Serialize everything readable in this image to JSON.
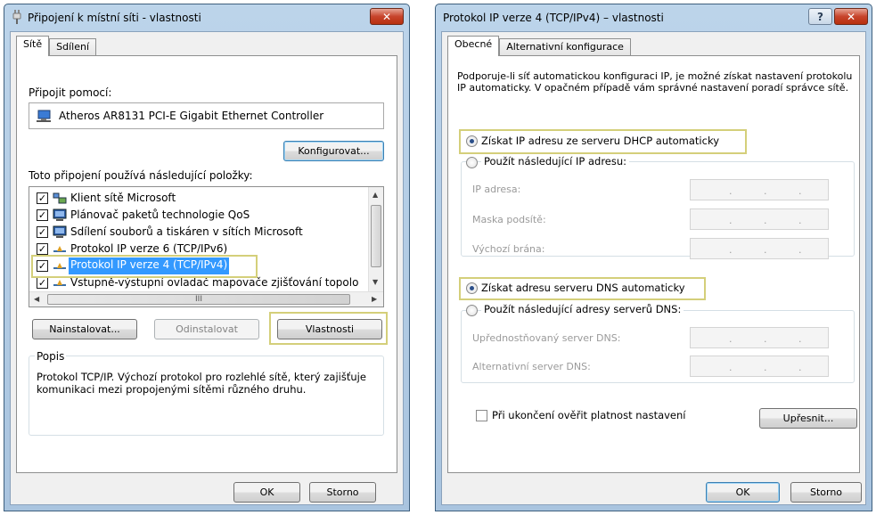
{
  "left_dialog": {
    "title": "Připojení k místní síti - vlastnosti",
    "tabs": [
      "Sítě",
      "Sdílení"
    ],
    "connect_using_label": "Připojit pomocí:",
    "adapter_name": "Atheros AR8131 PCI-E Gigabit Ethernet Controller",
    "configure_button": "Konfigurovat...",
    "items_label": "Toto připojení používá následující položky:",
    "items": [
      {
        "label": "Klient sítě Microsoft",
        "checked": true,
        "icon": "network-client-icon"
      },
      {
        "label": "Plánovač paketů technologie QoS",
        "checked": true,
        "icon": "network-service-icon"
      },
      {
        "label": "Sdílení souborů a tiskáren v sítích Microsoft",
        "checked": true,
        "icon": "network-service-icon"
      },
      {
        "label": "Protokol IP verze 6 (TCP/IPv6)",
        "checked": true,
        "icon": "protocol-icon"
      },
      {
        "label": "Protokol IP verze 4 (TCP/IPv4)",
        "checked": true,
        "icon": "protocol-icon",
        "selected": true
      },
      {
        "label": "Vstupně-výstupní ovladač mapovače zjišťování topolo",
        "checked": true,
        "icon": "protocol-icon"
      }
    ],
    "hscroll_grip": "III",
    "install_button": "Nainstalovat...",
    "uninstall_button": "Odinstalovat",
    "properties_button": "Vlastnosti",
    "description_group_label": "Popis",
    "description_text": "Protokol TCP/IP. Výchozí protokol pro rozlehlé sítě, který zajišťuje komunikaci mezi propojenými sítěmi různého druhu.",
    "ok_button": "OK",
    "cancel_button": "Storno"
  },
  "right_dialog": {
    "title": "Protokol IP verze 4 (TCP/IPv4) – vlastnosti",
    "help_button": "?",
    "tabs": [
      "Obecné",
      "Alternativní konfigurace"
    ],
    "intro_text": "Podporuje-li síť automatickou konfiguraci IP, je možné získat nastavení protokolu IP automaticky. V opačném případě vám správné nastavení poradí správce sítě.",
    "ip_auto_radio": "Získat IP adresu ze serveru DHCP automaticky",
    "ip_manual_radio": "Použít následující IP adresu:",
    "ip_address_label": "IP adresa:",
    "subnet_label": "Maska podsítě:",
    "gateway_label": "Výchozí brána:",
    "dns_auto_radio": "Získat adresu serveru DNS automaticky",
    "dns_manual_radio": "Použít následující adresy serverů DNS:",
    "preferred_dns_label": "Upřednostňovaný server DNS:",
    "alternate_dns_label": "Alternativní server DNS:",
    "validate_checkbox": "Při ukončení ověřit platnost nastavení",
    "advanced_button": "Upřesnit...",
    "ok_button": "OK",
    "cancel_button": "Storno",
    "ip_dot": "."
  },
  "colors": {
    "highlight_frame": "#d4cf7a",
    "selection": "#3399ff",
    "close_button": "#c7442c"
  }
}
